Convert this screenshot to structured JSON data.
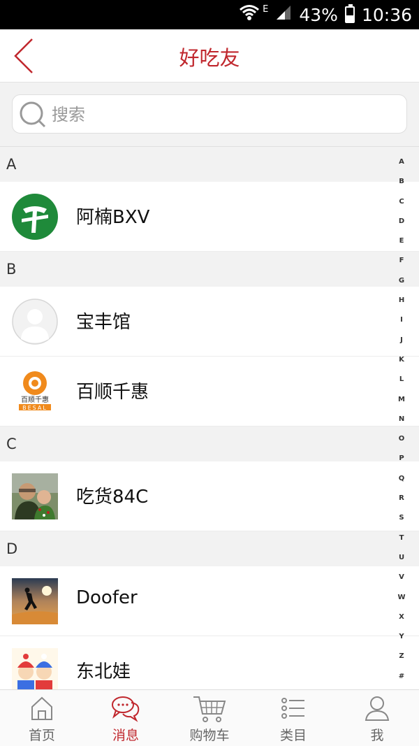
{
  "status_bar": {
    "signal_label": "E",
    "battery": "43%",
    "battery_level": 0.43,
    "time": "10:36"
  },
  "header": {
    "title": "好吃友",
    "back_icon": "chevron-left-icon"
  },
  "search": {
    "placeholder": "搜索",
    "value": ""
  },
  "sections": [
    {
      "letter": "A",
      "contacts": [
        {
          "name": "阿楠BXV",
          "avatar": "green-logo"
        }
      ]
    },
    {
      "letter": "B",
      "contacts": [
        {
          "name": "宝丰馆",
          "avatar": "default-person"
        },
        {
          "name": "百顺千惠",
          "avatar": "besal-logo",
          "logo_text": "百顺千惠",
          "logo_sub": "BESAL"
        }
      ]
    },
    {
      "letter": "C",
      "contacts": [
        {
          "name": "吃货84C",
          "avatar": "photo"
        }
      ]
    },
    {
      "letter": "D",
      "contacts": [
        {
          "name": "Doofer",
          "avatar": "sunset-photo"
        },
        {
          "name": "东北娃",
          "avatar": "cartoon"
        }
      ]
    }
  ],
  "alphabet_index": [
    "A",
    "B",
    "C",
    "D",
    "E",
    "F",
    "G",
    "H",
    "I",
    "J",
    "K",
    "L",
    "M",
    "N",
    "O",
    "P",
    "Q",
    "R",
    "S",
    "T",
    "U",
    "V",
    "W",
    "X",
    "Y",
    "Z",
    "#"
  ],
  "tabs": [
    {
      "label": "首页",
      "icon": "home-icon",
      "active": false
    },
    {
      "label": "消息",
      "icon": "chat-icon",
      "active": true
    },
    {
      "label": "购物车",
      "icon": "cart-icon",
      "active": false
    },
    {
      "label": "类目",
      "icon": "list-icon",
      "active": false
    },
    {
      "label": "我",
      "icon": "person-icon",
      "active": false
    }
  ],
  "colors": {
    "accent": "#c0272d",
    "background": "#f2f2f2",
    "status_bar": "#000000"
  }
}
